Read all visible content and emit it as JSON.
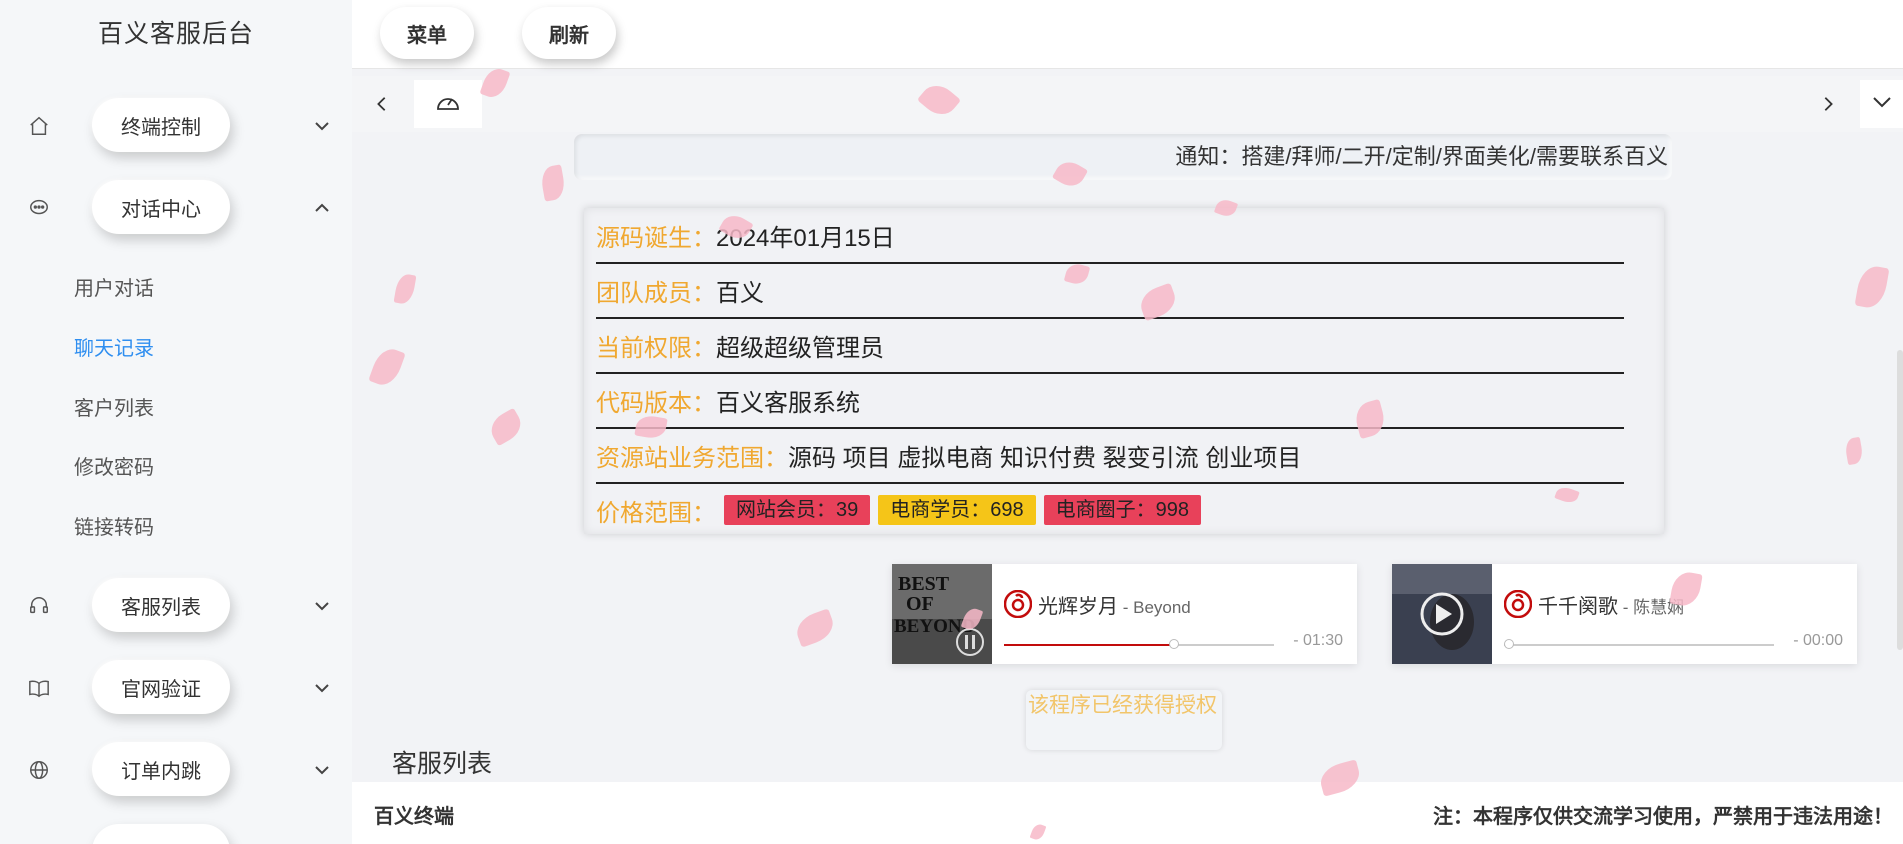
{
  "sidebar": {
    "brand": "百义客服后台",
    "groups": [
      {
        "label": "终端控制",
        "icon": "home-icon",
        "expanded": false
      },
      {
        "label": "对话中心",
        "icon": "chat-icon",
        "expanded": true
      },
      {
        "label": "客服列表",
        "icon": "headset-icon",
        "expanded": false
      },
      {
        "label": "官网验证",
        "icon": "book-icon",
        "expanded": false
      },
      {
        "label": "订单内跳",
        "icon": "globe-icon",
        "expanded": false
      }
    ],
    "sub_items": [
      {
        "label": "用户对话",
        "active": false
      },
      {
        "label": "聊天记录",
        "active": true
      },
      {
        "label": "客户列表",
        "active": false
      },
      {
        "label": "修改密码",
        "active": false
      },
      {
        "label": "链接转码",
        "active": false
      }
    ]
  },
  "topbar": {
    "menu_label": "菜单",
    "refresh_label": "刷新"
  },
  "notice": "通知：搭建/拜师/二开/定制/界面美化/需要联系百义",
  "info": {
    "rows": [
      {
        "label": "源码诞生：",
        "value": "2024年01月15日"
      },
      {
        "label": "团队成员：",
        "value": "百义"
      },
      {
        "label": "当前权限：",
        "value": "超级超级管理员"
      },
      {
        "label": "代码版本：",
        "value": "百义客服系统"
      },
      {
        "label": "资源站业务范围：",
        "value": "源码 项目 虚拟电商 知识付费 裂变引流 创业项目"
      }
    ],
    "price_label": "价格范围：",
    "prices": [
      {
        "text": "网站会员：39",
        "color": "#e8415a"
      },
      {
        "text": "电商学员：698",
        "color": "#f5c518"
      },
      {
        "text": "电商圈子：998",
        "color": "#e8415a"
      }
    ]
  },
  "music": [
    {
      "title": "光辉岁月",
      "artist": "Beyond",
      "time": "- 01:30",
      "progress": 0.63,
      "album_text": "BEST OF BEYOND"
    },
    {
      "title": "千千阕歌",
      "artist": "陈慧娴",
      "time": "- 00:00",
      "progress": 0.0,
      "album_text": ""
    }
  ],
  "auth_text": "该程序已经获得授权",
  "section_title": "客服列表",
  "footer": {
    "left": "百义终端",
    "right": "注：本程序仅供交流学习使用，严禁用于违法用途！"
  },
  "colors": {
    "accent": "#2e8ef0",
    "label_orange": "#f0a830",
    "netease_red": "#c20c0c"
  }
}
